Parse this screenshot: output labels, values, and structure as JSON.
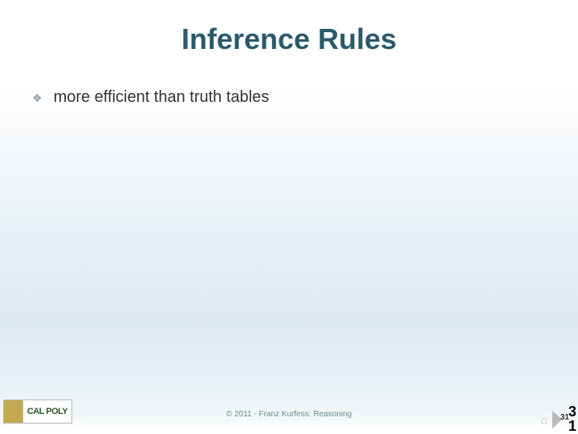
{
  "title": "Inference Rules",
  "bullets": [
    {
      "text": "more efficient than truth tables"
    }
  ],
  "footer": {
    "logo_text": "CAL POLY",
    "copyright": "© 2011 - Franz Kurfess: Reasoning",
    "page_front": "31",
    "page_back_top": "3",
    "page_back_bottom": "1"
  }
}
